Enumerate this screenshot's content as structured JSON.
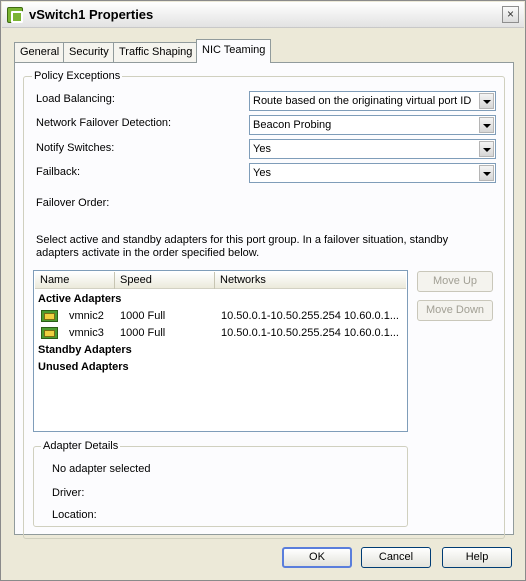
{
  "window": {
    "title": "vSwitch1 Properties",
    "close_glyph": "×"
  },
  "tabs": [
    {
      "label": "General"
    },
    {
      "label": "Security"
    },
    {
      "label": "Traffic Shaping"
    },
    {
      "label": "NIC Teaming"
    }
  ],
  "policy": {
    "legend": "Policy Exceptions",
    "load_balancing": {
      "label": "Load Balancing:",
      "value": "Route based on the originating virtual port ID"
    },
    "failover_detection": {
      "label": "Network Failover Detection:",
      "value": "Beacon Probing"
    },
    "notify_switches": {
      "label": "Notify Switches:",
      "value": "Yes"
    },
    "failback": {
      "label": "Failback:",
      "value": "Yes"
    },
    "failover_order_label": "Failover Order:",
    "instructions_line1": "Select active and standby adapters for this port group.  In a failover situation, standby",
    "instructions_line2": "adapters activate  in the order specified below."
  },
  "adapters": {
    "columns": [
      "Name",
      "Speed",
      "Networks"
    ],
    "groups": {
      "active": "Active Adapters",
      "standby": "Standby Adapters",
      "unused": "Unused Adapters"
    },
    "rows": [
      {
        "name": "vmnic2",
        "speed": "1000 Full",
        "networks": "10.50.0.1-10.50.255.254 10.60.0.1..."
      },
      {
        "name": "vmnic3",
        "speed": "1000 Full",
        "networks": "10.50.0.1-10.50.255.254 10.60.0.1..."
      }
    ],
    "move_up": "Move Up",
    "move_down": "Move Down"
  },
  "details": {
    "legend": "Adapter Details",
    "status": "No adapter selected",
    "driver_label": "Driver:",
    "location_label": "Location:"
  },
  "footer": {
    "ok": "OK",
    "cancel": "Cancel",
    "help": "Help"
  }
}
